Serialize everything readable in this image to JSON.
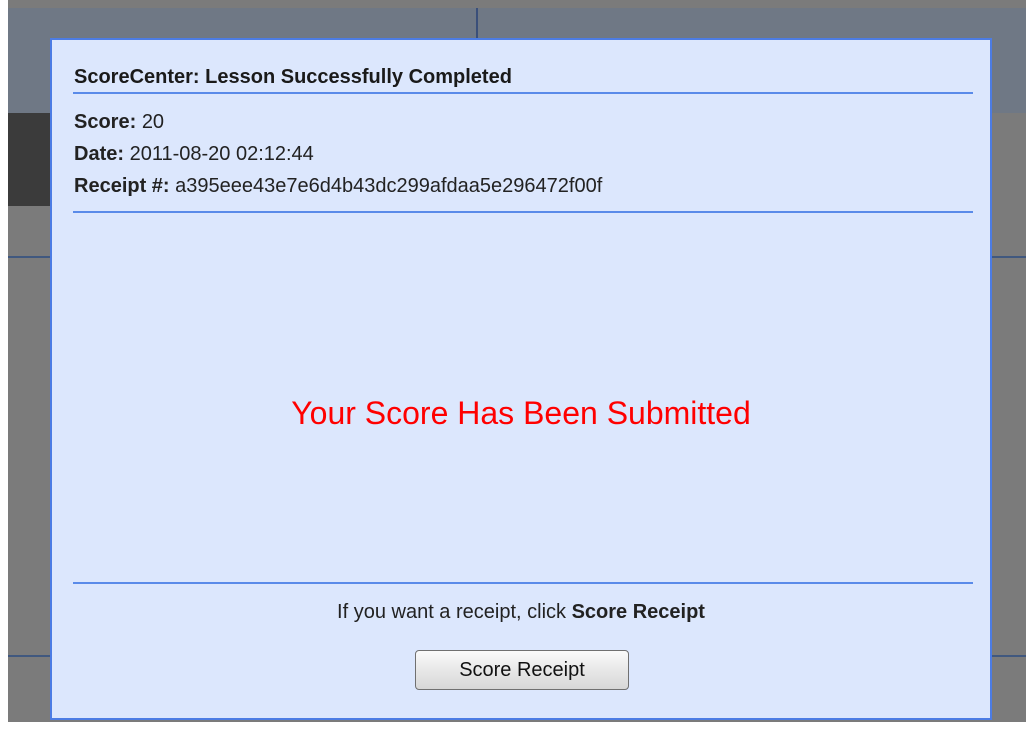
{
  "dialog": {
    "title": "ScoreCenter: Lesson Successfully Completed",
    "score_label": "Score:",
    "score_value": "20",
    "date_label": "Date:",
    "date_value": "2011-08-20 02:12:44",
    "receipt_label": "Receipt #:",
    "receipt_value": "a395eee43e7e6d4b43dc299afdaa5e296472f00f",
    "status_message": "Your Score Has Been Submitted",
    "receipt_prompt_text": "If you want a receipt, click",
    "receipt_prompt_emphasis": "Score Receipt",
    "button_label": "Score Receipt"
  },
  "colors": {
    "dialog_background": "#dce7fd",
    "dialog_border": "#4c7ce4",
    "status_message": "#ff0000",
    "overlay": "#7b7b7b"
  }
}
